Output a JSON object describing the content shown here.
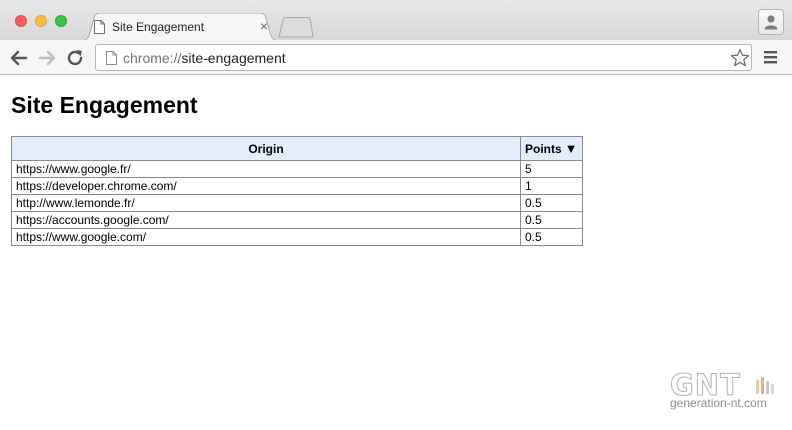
{
  "window": {
    "controls": [
      "close-icon",
      "minimize-icon",
      "maximize-icon"
    ]
  },
  "tab": {
    "title": "Site Engagement",
    "close_glyph": "×",
    "icon": "page-icon"
  },
  "toolbar": {
    "url_scheme": "chrome://",
    "url_path": "site-engagement",
    "icons": [
      "back-arrow-icon",
      "forward-arrow-icon",
      "reload-icon",
      "page-icon",
      "star-icon",
      "menu-icon",
      "profile-icon"
    ]
  },
  "page": {
    "title": "Site Engagement",
    "table": {
      "headers": {
        "origin": "Origin",
        "points": "Points",
        "sort_glyph": "▼"
      },
      "rows": [
        {
          "origin": "https://www.google.fr/",
          "points": "5"
        },
        {
          "origin": "https://developer.chrome.com/",
          "points": "1"
        },
        {
          "origin": "http://www.lemonde.fr/",
          "points": "0.5"
        },
        {
          "origin": "https://accounts.google.com/",
          "points": "0.5"
        },
        {
          "origin": "https://www.google.com/",
          "points": "0.5"
        }
      ]
    }
  },
  "watermark": {
    "logo": "GNT",
    "domain": "generation-nt.com"
  },
  "colors": {
    "header_cell_bg": "#e3edfc",
    "close": "#fc605c",
    "minimize": "#fdbc40",
    "maximize": "#34c84a"
  }
}
